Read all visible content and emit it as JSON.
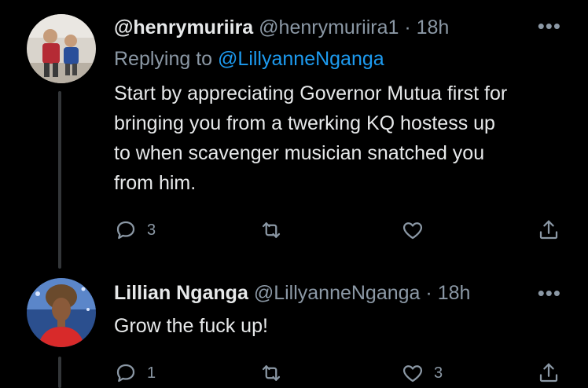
{
  "tweets": [
    {
      "display_name": "@henrymuriira",
      "handle": "@henrymuriira1",
      "separator": "·",
      "time": "18h",
      "replying_prefix": "Replying to",
      "replying_to": "@LillyanneNganga",
      "text": "Start by appreciating Governor Mutua first for\nbringing you  from  a twerking KQ hostess up\nto when scavenger musician snatched you\nfrom him.",
      "more": "•••",
      "reply_count": "3",
      "retweet_count": "",
      "like_count": ""
    },
    {
      "display_name": "Lillian Nganga",
      "handle": "@LillyanneNganga",
      "separator": "·",
      "time": "18h",
      "text": "Grow the fuck up!",
      "more": "•••",
      "reply_count": "1",
      "retweet_count": "",
      "like_count": "3"
    }
  ],
  "colors": {
    "background": "#000000",
    "primary_text": "#e7e9ea",
    "secondary_text": "#8b98a5",
    "link": "#1d9bf0",
    "thread_line": "#333639"
  },
  "icons": [
    "reply-icon",
    "retweet-icon",
    "like-icon",
    "share-icon",
    "more-icon"
  ]
}
